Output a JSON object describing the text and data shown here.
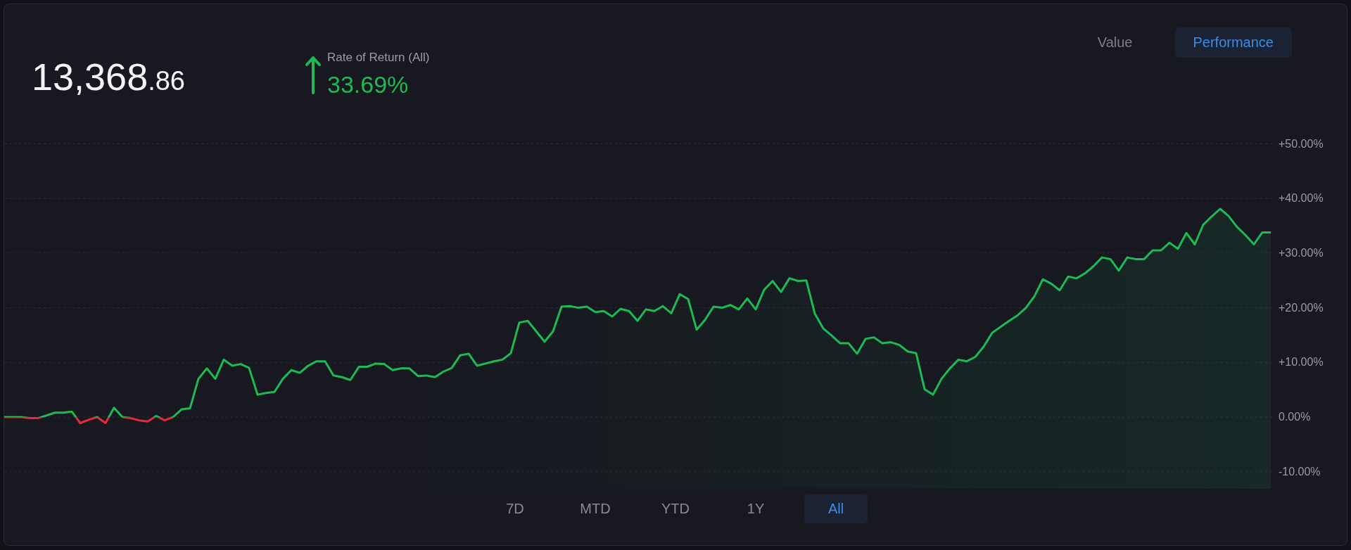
{
  "balance": {
    "whole": "13,368",
    "decimals": ".86"
  },
  "rate_of_return": {
    "label": "Rate of Return (All)",
    "value": "33.69%",
    "positive": true
  },
  "view_toggle": [
    {
      "label": "Value",
      "selected": false
    },
    {
      "label": "Performance",
      "selected": true
    }
  ],
  "chart_data": {
    "type": "area",
    "grid": true,
    "ylim": [
      -10,
      50
    ],
    "yticks": [
      {
        "value": 50,
        "label": "+50.00%"
      },
      {
        "value": 40,
        "label": "+40.00%"
      },
      {
        "value": 30,
        "label": "+30.00%"
      },
      {
        "value": 20,
        "label": "+20.00%"
      },
      {
        "value": 10,
        "label": "+10.00%"
      },
      {
        "value": 0,
        "label": "0.00%"
      },
      {
        "value": -10,
        "label": "-10.00%"
      }
    ],
    "series": [
      {
        "color": "#1db954",
        "values": [
          0,
          0,
          0,
          -0.2,
          -0.2,
          0.3,
          0.8,
          0.8,
          1,
          -1.1,
          -0.5,
          0,
          -1.1,
          1.7,
          0,
          -0.2,
          -0.6,
          -0.8,
          0.2,
          -0.6,
          0,
          1.4,
          1.6,
          7,
          8.9,
          7,
          10.5,
          9.4,
          9.7,
          9,
          4.1,
          4.4,
          4.6,
          7,
          8.6,
          8.1,
          9.4,
          10.2,
          10.2,
          7.6,
          7.3,
          6.8,
          9.2,
          9.2,
          9.8,
          9.7,
          8.6,
          8.9,
          8.9,
          7.5,
          7.6,
          7.3,
          8.3,
          9,
          11.3,
          11.6,
          9.4,
          9.8,
          10.2,
          10.5,
          11.7,
          17.3,
          17.6,
          15.7,
          13.8,
          15.7,
          20.2,
          20.3,
          20,
          20.2,
          19.2,
          19.4,
          18.4,
          19.8,
          19.4,
          17.6,
          19.7,
          19.4,
          20.3,
          19,
          22.5,
          21.6,
          16,
          17.8,
          20.2,
          20,
          20.5,
          19.7,
          21.7,
          19.7,
          23.3,
          24.9,
          22.9,
          25.4,
          24.9,
          25,
          18.9,
          16.2,
          14.9,
          13.5,
          13.5,
          11.6,
          14.3,
          14.6,
          13.5,
          13.7,
          13.2,
          12,
          11.7,
          5.1,
          4.1,
          7,
          8.9,
          10.5,
          10.2,
          11,
          12.9,
          15.4,
          16.5,
          17.6,
          18.6,
          20,
          22.1,
          25.2,
          24.4,
          23.2,
          25.7,
          25.4,
          26.3,
          27.6,
          29.2,
          28.9,
          26.8,
          29.2,
          28.9,
          28.9,
          30.5,
          30.5,
          31.9,
          30.8,
          33.7,
          31.6,
          35.2,
          36.7,
          38.1,
          36.8,
          34.8,
          33.3,
          31.6,
          33.8,
          33.8
        ]
      }
    ]
  },
  "range_buttons": [
    {
      "label": "7D",
      "selected": false
    },
    {
      "label": "MTD",
      "selected": false
    },
    {
      "label": "YTD",
      "selected": false
    },
    {
      "label": "1Y",
      "selected": false
    },
    {
      "label": "All",
      "selected": true
    }
  ]
}
